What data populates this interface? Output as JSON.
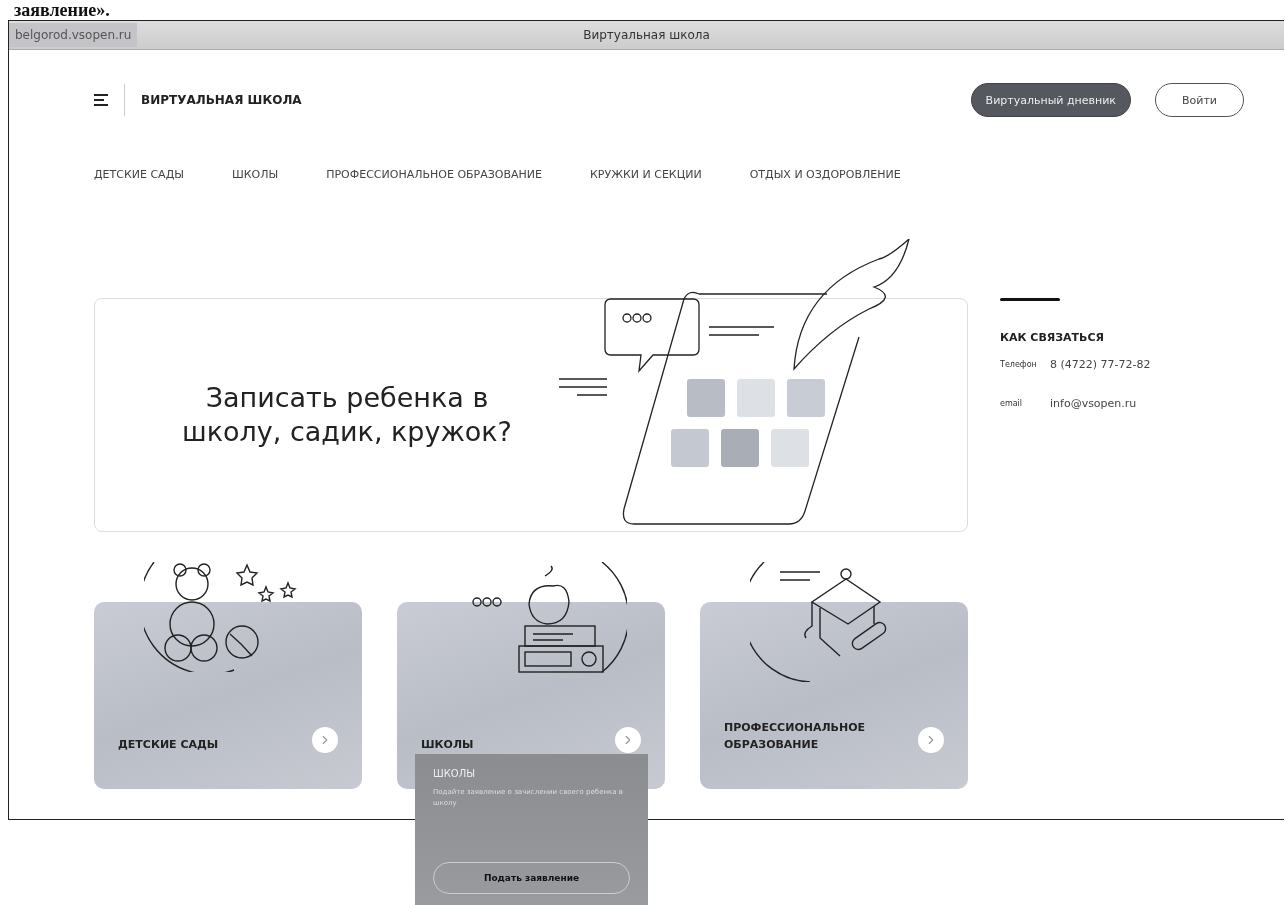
{
  "document_fragment": "заявление».",
  "browser": {
    "url": "belgorod.vsopen.ru",
    "title": "Виртуальная школа"
  },
  "header": {
    "brand": "ВИРТУАЛЬНАЯ ШКОЛА",
    "buttons": [
      {
        "label": "Виртуальный дневник",
        "kind": "filled"
      },
      {
        "label": "Войти",
        "kind": "outline"
      }
    ]
  },
  "nav": [
    "ДЕТСКИЕ САДЫ",
    "ШКОЛЫ",
    "ПРОФЕССИОНАЛЬНОЕ ОБРАЗОВАНИЕ",
    "КРУЖКИ И СЕКЦИИ",
    "ОТДЫХ И ОЗДОРОВЛЕНИЕ"
  ],
  "hero": {
    "heading": "Записать ребенка в школу, садик, кружок?"
  },
  "contacts": {
    "title": "КАК СВЯЗАТЬСЯ",
    "rows": [
      {
        "label": "Телефон",
        "value": "8 (4722) 77-72-82"
      },
      {
        "label": "email",
        "value": "info@vsopen.ru"
      }
    ]
  },
  "cards": [
    {
      "title": "ДЕТСКИЕ САДЫ",
      "kind": "bear"
    },
    {
      "title": "ШКОЛЫ",
      "kind": "school"
    },
    {
      "title": "ПРОФЕССИОНАЛЬНОЕ ОБРАЗОВАНИЕ",
      "kind": "cap"
    }
  ],
  "popup": {
    "title": "ШКОЛЫ",
    "text": "Подайте заявление о зачислении своего ребенка в школу",
    "button": "Подать заявление"
  }
}
